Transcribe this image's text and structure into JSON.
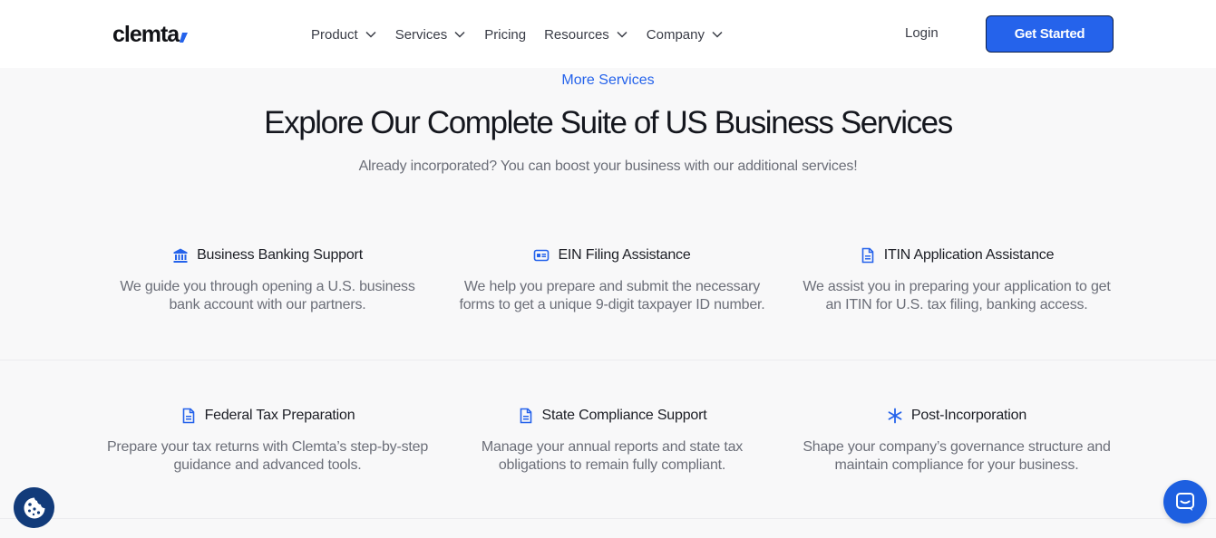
{
  "brand": {
    "logo_text": "clemta",
    "accent_color": "#2563eb"
  },
  "nav": {
    "items": [
      {
        "label": "Product",
        "has_dropdown": true
      },
      {
        "label": "Services",
        "has_dropdown": true
      },
      {
        "label": "Pricing",
        "has_dropdown": false
      },
      {
        "label": "Resources",
        "has_dropdown": true
      },
      {
        "label": "Company",
        "has_dropdown": true
      }
    ],
    "login_label": "Login",
    "cta_label": "Get Started"
  },
  "hero": {
    "eyebrow": "More Services",
    "headline": "Explore Our Complete Suite of US Business Services",
    "subtitle": "Already incorporated? You can boost your business with our additional services!"
  },
  "services": [
    {
      "icon": "bank-icon",
      "title": "Business Banking Support",
      "description": "We guide you through opening a U.S. business bank account with our partners."
    },
    {
      "icon": "id-card-icon",
      "title": "EIN Filing Assistance",
      "description": "We help you prepare and submit the necessary forms to get a unique 9-digit taxpayer ID number."
    },
    {
      "icon": "document-icon",
      "title": "ITIN Application Assistance",
      "description": "We assist you in preparing your application to get an ITIN for U.S. tax filing, banking access."
    },
    {
      "icon": "document-icon",
      "title": "Federal Tax Preparation",
      "description": "Prepare your tax returns with Clemta’s step-by-step guidance and advanced tools."
    },
    {
      "icon": "document-icon",
      "title": "State Compliance Support",
      "description": "Manage your annual reports and state tax obligations to remain fully compliant."
    },
    {
      "icon": "asterisk-icon",
      "title": "Post-Incorporation",
      "description": "Shape your company’s governance structure and maintain compliance for your business."
    }
  ],
  "floating": {
    "cookie_icon": "cookie-icon",
    "chat_icon": "chat-icon"
  }
}
